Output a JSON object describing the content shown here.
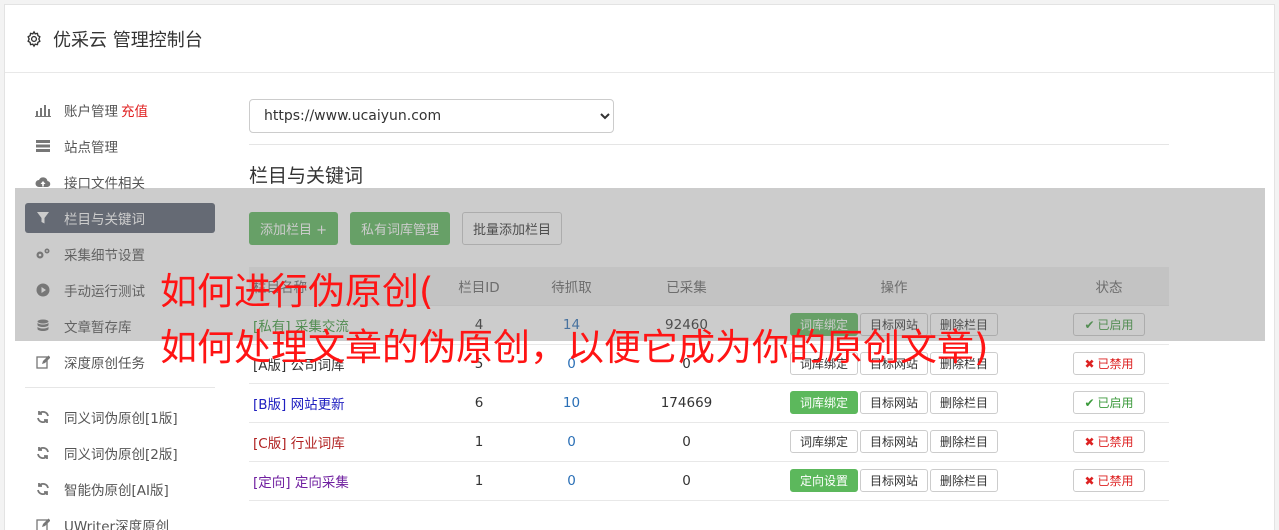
{
  "header": {
    "title": "优采云 管理控制台"
  },
  "sidebar": {
    "items": [
      {
        "label": "账户管理",
        "extra": "充值",
        "icon": "bar-chart-icon"
      },
      {
        "label": "站点管理",
        "icon": "server-icon"
      },
      {
        "label": "接口文件相关",
        "icon": "cloud-upload-icon"
      },
      {
        "label": "栏目与关键词",
        "icon": "filter-icon",
        "active": true
      },
      {
        "label": "采集细节设置",
        "icon": "gears-icon"
      },
      {
        "label": "手动运行测试",
        "icon": "play-circle-icon"
      },
      {
        "label": "文章暂存库",
        "icon": "database-icon"
      },
      {
        "label": "深度原创任务",
        "icon": "edit-icon"
      },
      {
        "label": "同义词伪原创[1版]",
        "icon": "refresh-icon"
      },
      {
        "label": "同义词伪原创[2版]",
        "icon": "refresh-icon"
      },
      {
        "label": "智能伪原创[AI版]",
        "icon": "refresh-icon"
      },
      {
        "label": "UWriter深度原创",
        "icon": "edit-icon"
      }
    ]
  },
  "main": {
    "site_select": "https://www.ucaiyun.com",
    "section_title": "栏目与关键词",
    "buttons": {
      "add_column": "添加栏目 +",
      "private_lib": "私有词库管理",
      "batch_add": "批量添加栏目"
    },
    "table": {
      "headers": [
        "栏目名称",
        "栏目ID",
        "待抓取",
        "已采集",
        "操作",
        "状态"
      ],
      "rows": [
        {
          "tag": "[私有]",
          "name": "采集交流",
          "id": "4",
          "pending": "14",
          "collected": "92460",
          "op1": "词库绑定",
          "op1_green": true,
          "op2": "目标网站",
          "op3": "删除栏目",
          "status": "已启用",
          "on": true,
          "color": "#3a9a3a"
        },
        {
          "tag": "[A版]",
          "name": "公司词库",
          "id": "5",
          "pending": "0",
          "collected": "0",
          "op1": "词库绑定",
          "op1_green": false,
          "op2": "目标网站",
          "op3": "删除栏目",
          "status": "已禁用",
          "on": false,
          "color": "#333333"
        },
        {
          "tag": "[B版]",
          "name": "网站更新",
          "id": "6",
          "pending": "10",
          "collected": "174669",
          "op1": "词库绑定",
          "op1_green": true,
          "op2": "目标网站",
          "op3": "删除栏目",
          "status": "已启用",
          "on": true,
          "color": "#2020c0"
        },
        {
          "tag": "[C版]",
          "name": "行业词库",
          "id": "1",
          "pending": "0",
          "collected": "0",
          "op1": "词库绑定",
          "op1_green": false,
          "op2": "目标网站",
          "op3": "删除栏目",
          "status": "已禁用",
          "on": false,
          "color": "#b02020"
        },
        {
          "tag": "[定向]",
          "name": "定向采集",
          "id": "1",
          "pending": "0",
          "collected": "0",
          "op1": "定向设置",
          "op1_green": true,
          "op2": "目标网站",
          "op3": "删除栏目",
          "status": "已禁用",
          "on": false,
          "color": "#7020a0"
        }
      ]
    }
  },
  "overlay": {
    "line1": "如何进行伪原创(",
    "line2": "如何处理文章的伪原创，以便它成为你的原创文章)"
  }
}
